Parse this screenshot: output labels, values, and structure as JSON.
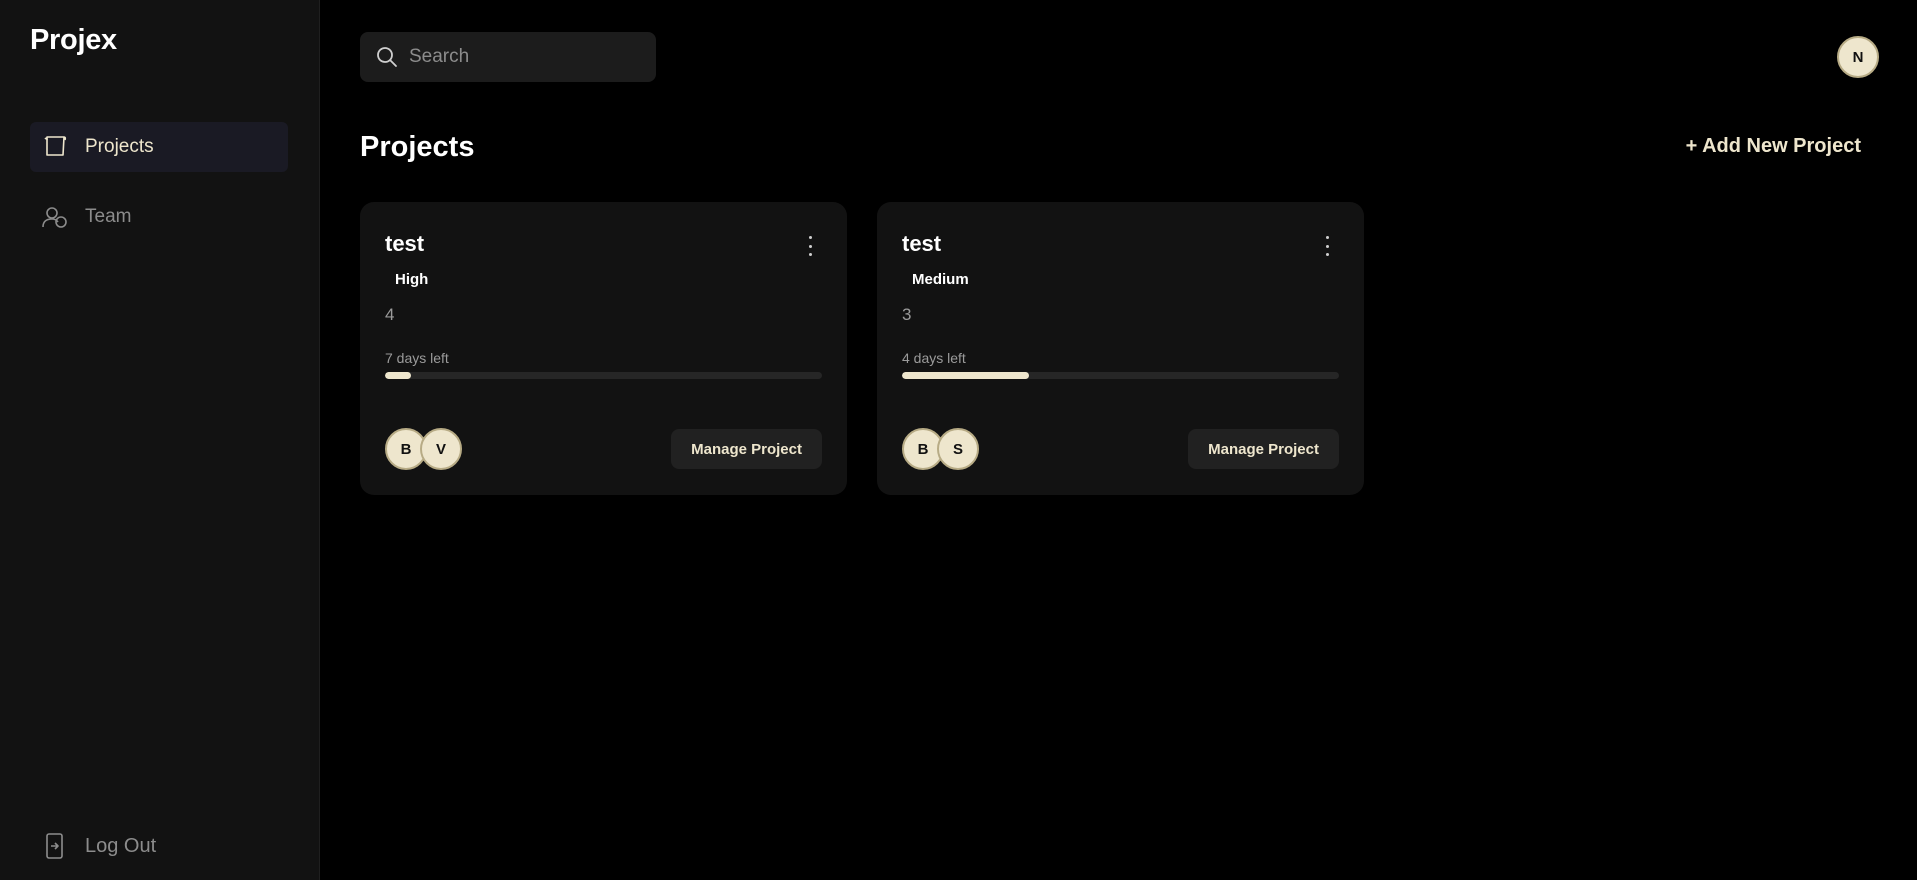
{
  "app": {
    "name": "Projex"
  },
  "sidebar": {
    "items": [
      {
        "label": "Projects",
        "icon": "projects-icon",
        "active": true
      },
      {
        "label": "Team",
        "icon": "team-icon",
        "active": false
      }
    ],
    "logout_label": "Log Out"
  },
  "header": {
    "search_placeholder": "Search",
    "user_initial": "N"
  },
  "page": {
    "title": "Projects",
    "add_button": "+ Add New Project"
  },
  "projects": [
    {
      "title": "test",
      "priority": "High",
      "count": "4",
      "days_left": "7 days left",
      "progress": 0.06,
      "members": [
        "B",
        "V"
      ],
      "manage_label": "Manage Project"
    },
    {
      "title": "test",
      "priority": "Medium",
      "count": "3",
      "days_left": "4 days left",
      "progress": 0.29,
      "members": [
        "B",
        "S"
      ],
      "manage_label": "Manage Project"
    }
  ],
  "colors": {
    "accent": "#eee6cd",
    "sidebar_bg": "#121212",
    "card_bg": "#121212",
    "page_bg": "#000000"
  }
}
